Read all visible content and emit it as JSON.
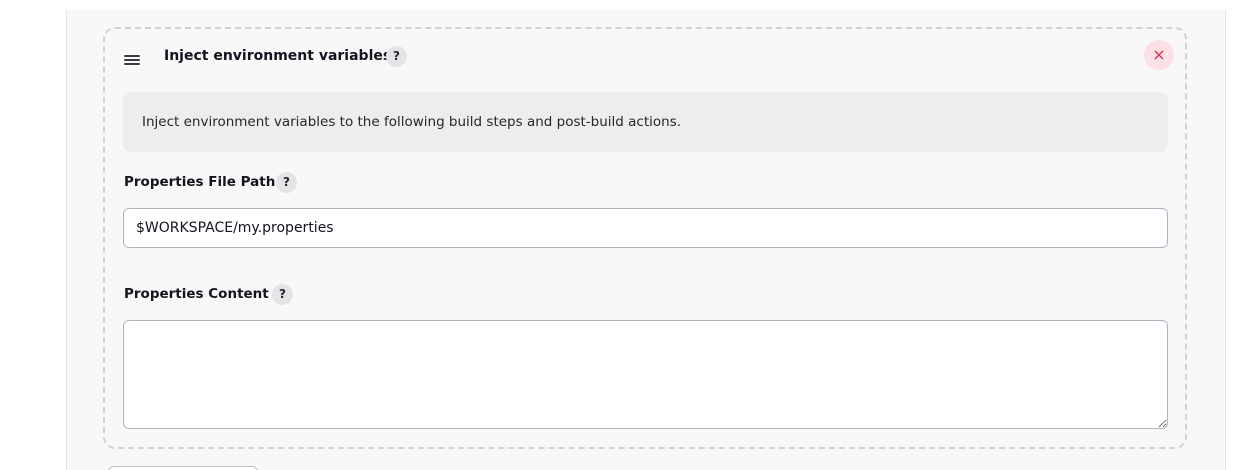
{
  "step": {
    "title": "Inject environment variables",
    "help_symbol": "?",
    "close_symbol": "×",
    "description": "Inject environment variables to the following build steps and post-build actions."
  },
  "fields": {
    "properties_file_path": {
      "label": "Properties File Path",
      "value": "$WORKSPACE/my.properties"
    },
    "properties_content": {
      "label": "Properties Content",
      "value": ""
    }
  },
  "icons": {
    "drag": "drag-handle-icon",
    "help": "help-icon",
    "close": "close-icon",
    "resize": "resize-grip-icon"
  },
  "colors": {
    "close_accent": "#e0284a",
    "close_background": "#fbe0e5",
    "description_background": "#ededed",
    "input_border": "#aeb4c0",
    "dashed_border": "#d2d2d2"
  }
}
